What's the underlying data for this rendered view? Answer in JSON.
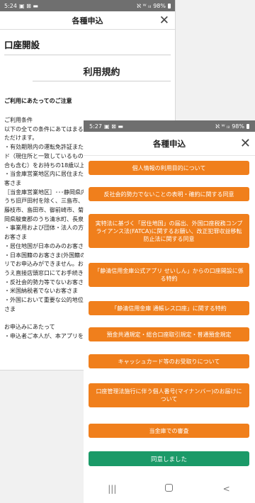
{
  "back": {
    "status": {
      "time": "5:24",
      "icons_left": "▣ ⊠ ▬",
      "icons_right": "ℵ ᵂ ₗᵢₗ",
      "battery": "98%"
    },
    "title": "各種申込",
    "section_title": "口座開設",
    "terms_heading": "利用規約",
    "notice_heading": "ご利用にあたってのご注意",
    "lines": [
      "ご利用条件",
      "以下の全ての条件にあてはまるお客さまのみお申込みい",
      "ただけます。",
      "・有効期限内の運転免許証またはマイナンバーカー",
      "ド（現住所と一致しているもの）（住所変更届出の場",
      "合も含む）をお持ちの18歳以上の個人のお客さま",
      "・当金庫営業地区内に居住または勤務されているお",
      "客さま",
      "［当金庫営業地区］･･･静岡県内（賀茂郡東伊豆町の",
      "うち旧戸田村を除く、三島市、伊東市、熱海市、",
      "藤枝市、島田市、御前崎市、菊川市、牧之原市、",
      "岡県駿東郡のうち清水町、長泉町）",
      "・事業用および団体・法人の方のお申込みはできない",
      "お客さま",
      "・居住地国が日本のみのお客さま",
      "・日本国籍のお客さま(外国籍のお客さまは日本国内の窓",
      "リでお申込みができません。お手数ですが、本人確認書類の",
      "うえ直接店頭窓口にてお手続きください。)",
      "・反社会的勢力等でないお客さま",
      "・米国納税者でないお客さま",
      "・外国において重要な公的地位にある方やその家族でないお客",
      "さま",
      "",
      "お申込みにあたって",
      "・申込者ご本人が、本アプリを使用してお申込みください。"
    ]
  },
  "front": {
    "status": {
      "time": "5:27",
      "icons_left": "▣ ⊠ ▬",
      "icons_right": "ℵ ᵂ ₗᵢₗ",
      "battery": "98%"
    },
    "title": "各種申込",
    "buttons": [
      "個人情報の利用目的について",
      "反社会的勢力でないことの表明・確約に関する同意",
      "実特法に基づく「居住地国」の届出、外国口座税務コンプライアンス法(FATCA)に関するお願い、改正犯罪収益移転防止法に関する同意",
      "「静清信用金庫公式アプリ せいしん」からの口座開設に係る特約",
      "「静清信用金庫 通帳レス口座」に関する特約",
      "預金共通規定・総合口座取引規定・普通預金規定",
      "キャッシュカード等のお受取りについて",
      "口座管理法施行に伴う個人番号(マイナンバー)のお届けについて",
      "当金庫での審査"
    ],
    "agree_label": "同意しました",
    "nav": {
      "recent": "|||",
      "home": "",
      "back": "<"
    }
  },
  "colors": {
    "orange": "#f07f1c",
    "green": "#1b9a68",
    "status_bar": "#6f6f6f"
  }
}
